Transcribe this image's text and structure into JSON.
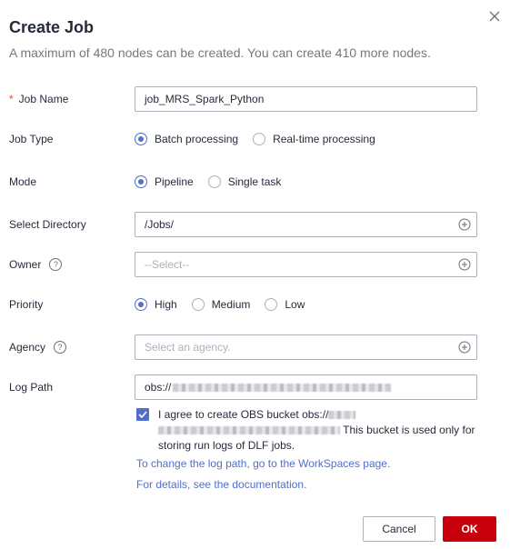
{
  "dialog": {
    "title": "Create Job",
    "subtitle": "A maximum of 480 nodes can be created. You can create 410 more nodes."
  },
  "form": {
    "job_name": {
      "required_mark": "*",
      "label": "Job Name",
      "value": "job_MRS_Spark_Python"
    },
    "job_type": {
      "label": "Job Type",
      "options": [
        "Batch processing",
        "Real-time processing"
      ],
      "selected": 0
    },
    "mode": {
      "label": "Mode",
      "options": [
        "Pipeline",
        "Single task"
      ],
      "selected": 0
    },
    "directory": {
      "label": "Select Directory",
      "value": "/Jobs/",
      "icon": "add-circle-icon"
    },
    "owner": {
      "label": "Owner",
      "help": "?",
      "placeholder": "--Select--",
      "icon": "add-circle-icon"
    },
    "priority": {
      "label": "Priority",
      "options": [
        "High",
        "Medium",
        "Low"
      ],
      "selected": 0
    },
    "agency": {
      "label": "Agency",
      "help": "?",
      "placeholder": "Select an agency.",
      "icon": "add-circle-icon"
    },
    "log_path": {
      "label": "Log Path",
      "value_prefix": "obs://"
    }
  },
  "agree": {
    "checked": true,
    "text_before": "I agree to create OBS bucket obs://",
    "text_after": " This bucket is used only for storing run logs of DLF jobs."
  },
  "links": {
    "change_log_path": "To change the log path, go to the WorkSpaces page.",
    "documentation": "For details, see the documentation."
  },
  "buttons": {
    "cancel": "Cancel",
    "ok": "OK"
  },
  "colors": {
    "accent": "#526ecc",
    "primary_button": "#c7000b",
    "required": "#e6452e"
  }
}
